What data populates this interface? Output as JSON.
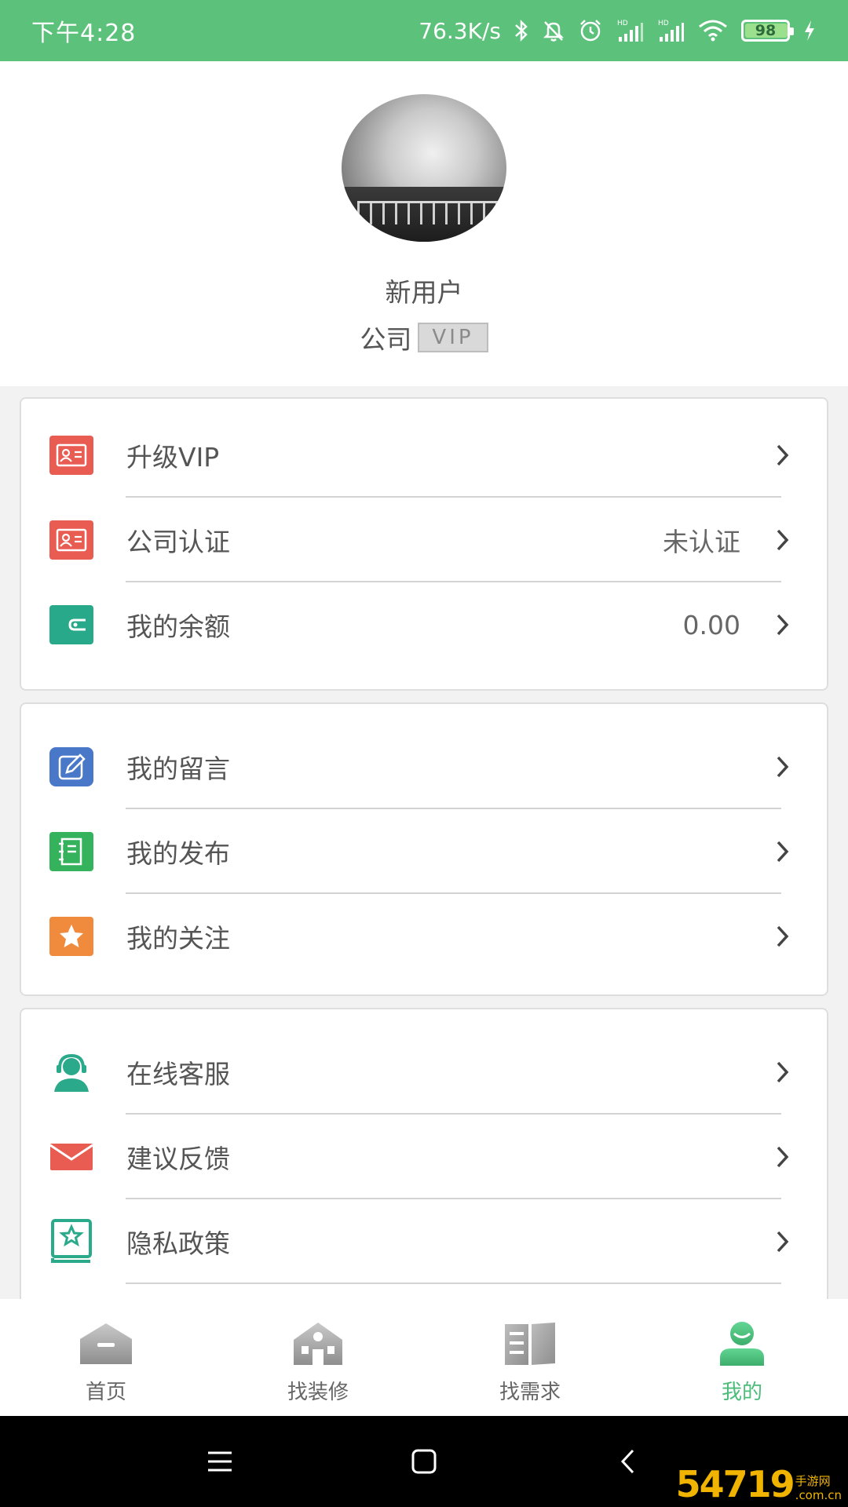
{
  "status_bar": {
    "time": "下午4:28",
    "network_speed": "76.3K/s",
    "battery": "98",
    "battery_level": 0.98,
    "icons": [
      "bluetooth-icon",
      "mute-icon",
      "alarm-icon",
      "hd-signal-icon",
      "hd-signal-icon",
      "wifi-icon",
      "battery-icon",
      "charging-icon"
    ]
  },
  "profile": {
    "username": "新用户",
    "company_label": "公司",
    "vip_badge": "VIP"
  },
  "menu_groups": [
    {
      "items": [
        {
          "label": "升级VIP",
          "value": "",
          "icon": "id-card-icon",
          "color": "#e85c52"
        },
        {
          "label": "公司认证",
          "value": "未认证",
          "icon": "id-card-icon",
          "color": "#e85c52"
        },
        {
          "label": "我的余额",
          "value": "0.00",
          "icon": "wallet-icon",
          "color": "#27a98a"
        }
      ]
    },
    {
      "items": [
        {
          "label": "我的留言",
          "value": "",
          "icon": "edit-icon",
          "color": "#4a78c9"
        },
        {
          "label": "我的发布",
          "value": "",
          "icon": "notebook-icon",
          "color": "#34b25c"
        },
        {
          "label": "我的关注",
          "value": "",
          "icon": "star-icon",
          "color": "#f08a3c"
        }
      ]
    },
    {
      "items": [
        {
          "label": "在线客服",
          "value": "",
          "icon": "customer-service-icon",
          "color": "#2aaa8a"
        },
        {
          "label": "建议反馈",
          "value": "",
          "icon": "mail-icon",
          "color": "#e85c52"
        },
        {
          "label": "隐私政策",
          "value": "",
          "icon": "privacy-book-icon",
          "color": "#2aaa8a"
        }
      ]
    }
  ],
  "bottom_nav": {
    "tabs": [
      {
        "label": "首页",
        "icon": "home-icon",
        "active": false
      },
      {
        "label": "找装修",
        "icon": "building-icon",
        "active": false
      },
      {
        "label": "找需求",
        "icon": "open-book-icon",
        "active": false
      },
      {
        "label": "我的",
        "icon": "user-icon",
        "active": true
      }
    ],
    "active_color": "#4cbc7b"
  },
  "system_nav": {
    "icons": [
      "menu-icon",
      "home-square-icon",
      "back-icon"
    ]
  },
  "watermark": {
    "big": "54719",
    "line1": "手游网",
    "line2": ".com.cn"
  },
  "colors": {
    "status_bar": "#5cc17a",
    "accent": "#4cbc7b"
  }
}
